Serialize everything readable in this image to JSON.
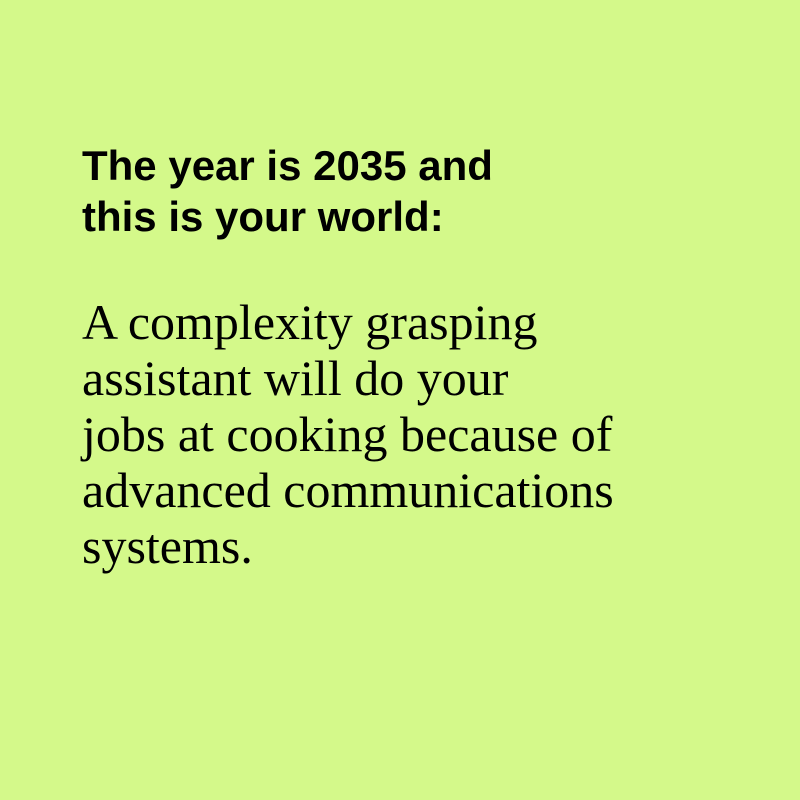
{
  "background_color": "#d4f98a",
  "text_color": "#000000",
  "heading": {
    "lines": [
      "The year is 2035 and",
      "this is your world:"
    ]
  },
  "body": {
    "lines": [
      "A complexity grasping",
      "assistant will do your",
      "jobs at cooking because of",
      "advanced communications",
      "systems."
    ]
  }
}
